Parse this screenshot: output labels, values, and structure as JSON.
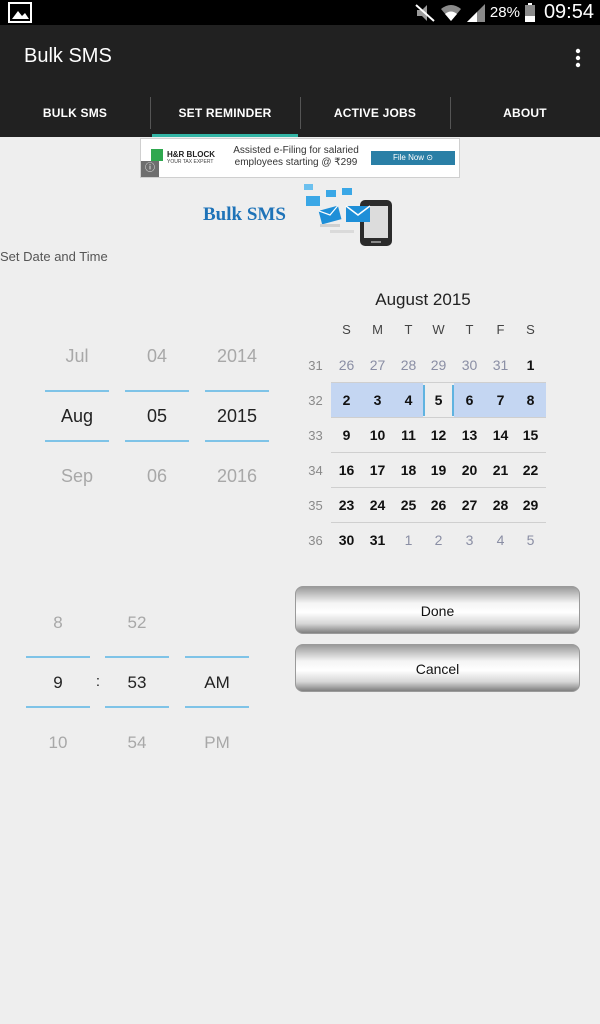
{
  "status_bar": {
    "battery": "28%",
    "time": "09:54",
    "icons": [
      "gallery-icon",
      "mute-icon",
      "wifi-icon",
      "signal-icon",
      "battery-icon"
    ]
  },
  "app_bar": {
    "title": "Bulk SMS"
  },
  "tabs": [
    {
      "label": "BULK SMS",
      "active": false
    },
    {
      "label": "SET REMINDER",
      "active": true
    },
    {
      "label": "ACTIVE JOBS",
      "active": false
    },
    {
      "label": "ABOUT",
      "active": false
    }
  ],
  "ad": {
    "brand": "H&R BLOCK",
    "tagline": "YOUR TAX EXPERT",
    "copy": "Assisted e-Filing for salaried employees starting @ ₹299",
    "cta": "File Now ⊙",
    "info": "ⓘ"
  },
  "logo": {
    "text": "Bulk SMS"
  },
  "section_label": "Set Date and Time",
  "date_picker": {
    "month": {
      "prev": "Jul",
      "current": "Aug",
      "next": "Sep"
    },
    "day": {
      "prev": "04",
      "current": "05",
      "next": "06"
    },
    "year": {
      "prev": "2014",
      "current": "2015",
      "next": "2016"
    }
  },
  "time_picker": {
    "hour": {
      "prev": "8",
      "current": "9",
      "next": "10"
    },
    "separator": ":",
    "minute": {
      "prev": "52",
      "current": "53",
      "next": "54"
    },
    "ampm": {
      "prev": "",
      "current": "AM",
      "next": "PM"
    }
  },
  "calendar": {
    "title": "August 2015",
    "weekdays": [
      "S",
      "M",
      "T",
      "W",
      "T",
      "F",
      "S"
    ],
    "selected_week": "32",
    "selected_day": "5",
    "weeks": [
      {
        "week": "31",
        "days": [
          {
            "d": "26",
            "out": true
          },
          {
            "d": "27",
            "out": true
          },
          {
            "d": "28",
            "out": true
          },
          {
            "d": "29",
            "out": true
          },
          {
            "d": "30",
            "out": true
          },
          {
            "d": "31",
            "out": true
          },
          {
            "d": "1",
            "out": false
          }
        ]
      },
      {
        "week": "32",
        "days": [
          {
            "d": "2",
            "out": false
          },
          {
            "d": "3",
            "out": false
          },
          {
            "d": "4",
            "out": false
          },
          {
            "d": "5",
            "out": false
          },
          {
            "d": "6",
            "out": false
          },
          {
            "d": "7",
            "out": false
          },
          {
            "d": "8",
            "out": false
          }
        ]
      },
      {
        "week": "33",
        "days": [
          {
            "d": "9",
            "out": false
          },
          {
            "d": "10",
            "out": false
          },
          {
            "d": "11",
            "out": false
          },
          {
            "d": "12",
            "out": false
          },
          {
            "d": "13",
            "out": false
          },
          {
            "d": "14",
            "out": false
          },
          {
            "d": "15",
            "out": false
          }
        ]
      },
      {
        "week": "34",
        "days": [
          {
            "d": "16",
            "out": false
          },
          {
            "d": "17",
            "out": false
          },
          {
            "d": "18",
            "out": false
          },
          {
            "d": "19",
            "out": false
          },
          {
            "d": "20",
            "out": false
          },
          {
            "d": "21",
            "out": false
          },
          {
            "d": "22",
            "out": false
          }
        ]
      },
      {
        "week": "35",
        "days": [
          {
            "d": "23",
            "out": false
          },
          {
            "d": "24",
            "out": false
          },
          {
            "d": "25",
            "out": false
          },
          {
            "d": "26",
            "out": false
          },
          {
            "d": "27",
            "out": false
          },
          {
            "d": "28",
            "out": false
          },
          {
            "d": "29",
            "out": false
          }
        ]
      },
      {
        "week": "36",
        "days": [
          {
            "d": "30",
            "out": false
          },
          {
            "d": "31",
            "out": false
          },
          {
            "d": "1",
            "out": true
          },
          {
            "d": "2",
            "out": true
          },
          {
            "d": "3",
            "out": true
          },
          {
            "d": "4",
            "out": true
          },
          {
            "d": "5",
            "out": true
          }
        ]
      }
    ]
  },
  "buttons": {
    "done": "Done",
    "cancel": "Cancel"
  },
  "colors": {
    "accent": "#33b5a5",
    "picker_line": "#7ec3e7",
    "selected_week": "#c4d6f2",
    "bar_bg": "#212121"
  }
}
